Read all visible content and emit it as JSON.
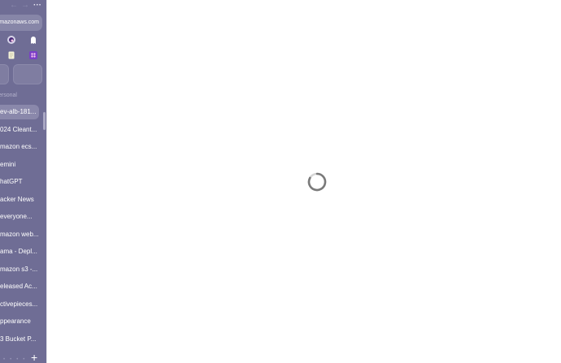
{
  "sidebar": {
    "nav": {
      "back_icon": "arrow-left-icon",
      "forward_icon": "arrow-right-icon",
      "more_label": "···"
    },
    "url": "mazonaws.com",
    "pinned": [
      {
        "icon": "pinned-app-icon"
      },
      {
        "icon": "ghost-icon"
      },
      {
        "icon": "document-icon"
      },
      {
        "icon": "app-grid-icon"
      }
    ],
    "section_label": "ersonal",
    "tabs": [
      {
        "label": "ev-alb-181..."
      },
      {
        "label": "024 Cleant..."
      },
      {
        "label": "mazon ecs..."
      },
      {
        "label": "emini"
      },
      {
        "label": "hatGPT"
      },
      {
        "label": "acker News"
      },
      {
        "label": "everyone..."
      },
      {
        "label": "mazon web..."
      },
      {
        "label": "ama - Depl..."
      },
      {
        "label": "mazon s3 -..."
      },
      {
        "label": "eleased Ac..."
      },
      {
        "label": "ctivepieces..."
      },
      {
        "label": "ppearance"
      },
      {
        "label": "3 Bucket P..."
      }
    ],
    "new_tab_label": "+"
  },
  "content": {
    "state": "loading",
    "spinner_icon": "loading-spinner-icon"
  },
  "colors": {
    "sidebar_bg": "#6f6d95",
    "active_tab": "#8a88ab",
    "spinner": "#7a7a7a"
  }
}
